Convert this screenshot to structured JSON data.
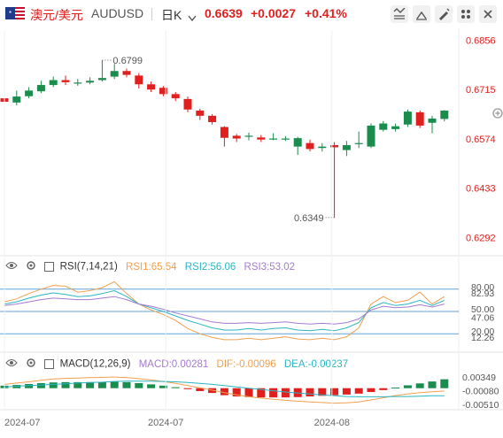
{
  "header": {
    "pair_cn": "澳元/美元",
    "symbol": "AUDUSD",
    "timeframe": "日K",
    "price": "0.6639",
    "change": "+0.0027",
    "change_pct": "+0.41%",
    "colors": {
      "up": "#e0201f",
      "down": "#1a8c4d",
      "accent": "#e0201f"
    }
  },
  "toolbar_icons": [
    "crosshair-icon",
    "fullscreen-icon",
    "draw-icon",
    "indicator-icon",
    "expand-icon",
    "close-icon"
  ],
  "chart_data": [
    {
      "type": "candlestick",
      "price_axis": [
        "0.6856",
        "0.6715",
        "0.6574",
        "0.6433",
        "0.6292"
      ],
      "ylim": [
        0.6245,
        0.6885
      ],
      "annotations": {
        "high": "0.6799",
        "low": "0.6349"
      },
      "candles": [
        {
          "o": 0.669,
          "c": 0.668,
          "h": 0.6705,
          "l": 0.6665
        },
        {
          "o": 0.6678,
          "c": 0.6695,
          "h": 0.6712,
          "l": 0.667
        },
        {
          "o": 0.6696,
          "c": 0.6712,
          "h": 0.6722,
          "l": 0.669
        },
        {
          "o": 0.671,
          "c": 0.6728,
          "h": 0.674,
          "l": 0.6705
        },
        {
          "o": 0.6728,
          "c": 0.6742,
          "h": 0.6752,
          "l": 0.6722
        },
        {
          "o": 0.6742,
          "c": 0.6736,
          "h": 0.6755,
          "l": 0.6728
        },
        {
          "o": 0.6732,
          "c": 0.6735,
          "h": 0.6745,
          "l": 0.6726
        },
        {
          "o": 0.6735,
          "c": 0.674,
          "h": 0.675,
          "l": 0.673
        },
        {
          "o": 0.6742,
          "c": 0.6748,
          "h": 0.6799,
          "l": 0.6738
        },
        {
          "o": 0.6752,
          "c": 0.6768,
          "h": 0.6788,
          "l": 0.6745
        },
        {
          "o": 0.6768,
          "c": 0.6757,
          "h": 0.6775,
          "l": 0.675
        },
        {
          "o": 0.6755,
          "c": 0.673,
          "h": 0.6762,
          "l": 0.6718
        },
        {
          "o": 0.673,
          "c": 0.6715,
          "h": 0.6738,
          "l": 0.6708
        },
        {
          "o": 0.672,
          "c": 0.6702,
          "h": 0.6725,
          "l": 0.6696
        },
        {
          "o": 0.6702,
          "c": 0.669,
          "h": 0.6708,
          "l": 0.6682
        },
        {
          "o": 0.6688,
          "c": 0.6658,
          "h": 0.6695,
          "l": 0.665
        },
        {
          "o": 0.6655,
          "c": 0.664,
          "h": 0.666,
          "l": 0.6628
        },
        {
          "o": 0.664,
          "c": 0.6622,
          "h": 0.6645,
          "l": 0.6615
        },
        {
          "o": 0.6608,
          "c": 0.6577,
          "h": 0.661,
          "l": 0.6552
        },
        {
          "o": 0.6583,
          "c": 0.6575,
          "h": 0.6588,
          "l": 0.6565
        },
        {
          "o": 0.6583,
          "c": 0.6583,
          "h": 0.6592,
          "l": 0.657
        },
        {
          "o": 0.6578,
          "c": 0.6572,
          "h": 0.6585,
          "l": 0.6565
        },
        {
          "o": 0.6575,
          "c": 0.6575,
          "h": 0.659,
          "l": 0.657
        },
        {
          "o": 0.6575,
          "c": 0.6575,
          "h": 0.6582,
          "l": 0.6568
        },
        {
          "o": 0.6552,
          "c": 0.6576,
          "h": 0.658,
          "l": 0.6528
        },
        {
          "o": 0.6562,
          "c": 0.6545,
          "h": 0.6572,
          "l": 0.6538
        },
        {
          "o": 0.6548,
          "c": 0.6552,
          "h": 0.6562,
          "l": 0.6538
        },
        {
          "o": 0.6556,
          "c": 0.655,
          "h": 0.6565,
          "l": 0.6349
        },
        {
          "o": 0.6542,
          "c": 0.6556,
          "h": 0.6568,
          "l": 0.6525
        },
        {
          "o": 0.656,
          "c": 0.6562,
          "h": 0.6595,
          "l": 0.6548
        },
        {
          "o": 0.6552,
          "c": 0.6612,
          "h": 0.6618,
          "l": 0.6548
        },
        {
          "o": 0.66,
          "c": 0.6618,
          "h": 0.6625,
          "l": 0.6595
        },
        {
          "o": 0.6602,
          "c": 0.661,
          "h": 0.6618,
          "l": 0.6595
        },
        {
          "o": 0.6615,
          "c": 0.6652,
          "h": 0.6658,
          "l": 0.6608
        },
        {
          "o": 0.665,
          "c": 0.6612,
          "h": 0.6655,
          "l": 0.6605
        },
        {
          "o": 0.662,
          "c": 0.6632,
          "h": 0.664,
          "l": 0.659
        },
        {
          "o": 0.6631,
          "c": 0.6655,
          "h": 0.6656,
          "l": 0.6624
        }
      ]
    },
    {
      "type": "line",
      "name": "RSI(7,14,21)",
      "legend": [
        "RSI1:65.54",
        "RSI2:56.06",
        "RSI3:53.02"
      ],
      "axis_labels": [
        "80.00",
        "82.93",
        "50.00",
        "47.06",
        "20.00",
        "12.26"
      ],
      "ylim": [
        0,
        100
      ],
      "series": [
        {
          "name": "RSI1",
          "color": "#f0a050",
          "values": [
            63,
            67,
            74,
            80,
            85,
            84,
            76,
            78,
            82,
            90,
            74,
            60,
            52,
            46,
            38,
            27,
            20,
            15,
            12,
            12,
            14,
            12,
            14,
            16,
            13,
            12,
            14,
            12,
            16,
            28,
            60,
            70,
            62,
            65,
            76,
            60,
            70
          ]
        },
        {
          "name": "RSI2",
          "color": "#2ab5c2",
          "values": [
            60,
            63,
            68,
            72,
            75,
            73,
            70,
            71,
            74,
            78,
            70,
            60,
            55,
            50,
            44,
            38,
            33,
            28,
            25,
            25,
            27,
            25,
            27,
            28,
            25,
            24,
            26,
            24,
            28,
            35,
            55,
            62,
            58,
            60,
            65,
            58,
            65
          ]
        },
        {
          "name": "RSI3",
          "color": "#a57bd0",
          "values": [
            58,
            60,
            63,
            66,
            68,
            67,
            66,
            66,
            68,
            70,
            66,
            60,
            57,
            53,
            48,
            44,
            40,
            36,
            34,
            34,
            35,
            34,
            35,
            36,
            34,
            33,
            34,
            33,
            35,
            40,
            52,
            57,
            55,
            56,
            59,
            56,
            60
          ]
        }
      ]
    },
    {
      "type": "bar",
      "name": "MACD(12,26,9)",
      "legend": [
        "MACD:0.00281",
        "DIF:-0.00096",
        "DEA:-0.00237"
      ],
      "axis_labels": [
        "0.00349",
        "-0.00080",
        "-0.00510"
      ],
      "ylim": [
        -0.0062,
        0.0052
      ],
      "hist": [
        0.0008,
        0.001,
        0.0013,
        0.0016,
        0.0018,
        0.0019,
        0.0019,
        0.0019,
        0.0019,
        0.002,
        0.0019,
        0.0016,
        0.0012,
        0.0008,
        0.0003,
        -0.0003,
        -0.0009,
        -0.0015,
        -0.0022,
        -0.0026,
        -0.0028,
        -0.0029,
        -0.0029,
        -0.0029,
        -0.0028,
        -0.0026,
        -0.0024,
        -0.0022,
        -0.002,
        -0.0017,
        -0.0012,
        -0.0006,
        0.0002,
        0.0009,
        0.0015,
        0.0021,
        0.0028
      ],
      "series": [
        {
          "name": "DIF",
          "color": "#f0a050",
          "values": [
            0.0012,
            0.0016,
            0.002,
            0.0025,
            0.0029,
            0.0031,
            0.0032,
            0.0033,
            0.0034,
            0.0035,
            0.0033,
            0.003,
            0.0026,
            0.0021,
            0.0015,
            0.0008,
            0.0001,
            -0.0006,
            -0.0014,
            -0.0021,
            -0.0027,
            -0.0031,
            -0.0035,
            -0.0038,
            -0.0041,
            -0.0043,
            -0.0045,
            -0.0047,
            -0.0046,
            -0.0043,
            -0.0037,
            -0.003,
            -0.0023,
            -0.0018,
            -0.0014,
            -0.0011,
            -0.0009
          ]
        },
        {
          "name": "DEA",
          "color": "#2ab5c2",
          "values": [
            0.0004,
            0.0006,
            0.0008,
            0.001,
            0.0012,
            0.0014,
            0.0016,
            0.0018,
            0.0019,
            0.0021,
            0.0022,
            0.0022,
            0.0022,
            0.0021,
            0.002,
            0.0018,
            0.0015,
            0.0012,
            0.0008,
            0.0004,
            0.0,
            -0.0004,
            -0.0008,
            -0.0012,
            -0.0015,
            -0.0018,
            -0.0021,
            -0.0024,
            -0.0026,
            -0.0027,
            -0.0027,
            -0.0027,
            -0.0026,
            -0.0026,
            -0.0025,
            -0.0024,
            -0.0024
          ]
        }
      ]
    }
  ],
  "x_axis": [
    "2024-07",
    "2024-07",
    "2024-08"
  ]
}
